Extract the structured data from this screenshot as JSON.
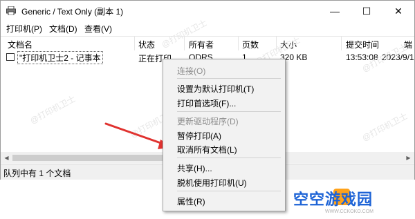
{
  "window": {
    "title": "Generic / Text Only (副本 1)",
    "minimize": "—",
    "maximize": "☐",
    "close": "✕"
  },
  "menubar": {
    "printer": "打印机(P)",
    "document": "文档(D)",
    "view": "查看(V)"
  },
  "columns": [
    "文档名",
    "状态",
    "所有者",
    "页数",
    "大小",
    "提交时间",
    "端"
  ],
  "job": {
    "name": "\"打印机卫士2 - 记事本",
    "status": "正在打印",
    "owner": "ODRS",
    "pages": "1",
    "size": "320 KB",
    "time": "13:53:08",
    "date": "2023/9/1"
  },
  "status_bar": "队列中有 1 个文档",
  "context_menu": {
    "connect": "连接(O)",
    "set_default": "设置为默认打印机(T)",
    "preferences": "打印首选项(F)...",
    "update_driver": "更新驱动程序(D)",
    "pause": "暂停打印(A)",
    "cancel_all": "取消所有文档(L)",
    "share": "共享(H)...",
    "offline": "脱机使用打印机(U)",
    "properties": "属性(R)"
  },
  "watermark": "@打印机卫士",
  "logo": {
    "text": "空空游戏园",
    "url": "WWW.CCKOKO.COM"
  },
  "colors": {
    "arrow": "#e0322f",
    "logo": "#1d63d6",
    "logo_accent": "#ffa21a"
  }
}
